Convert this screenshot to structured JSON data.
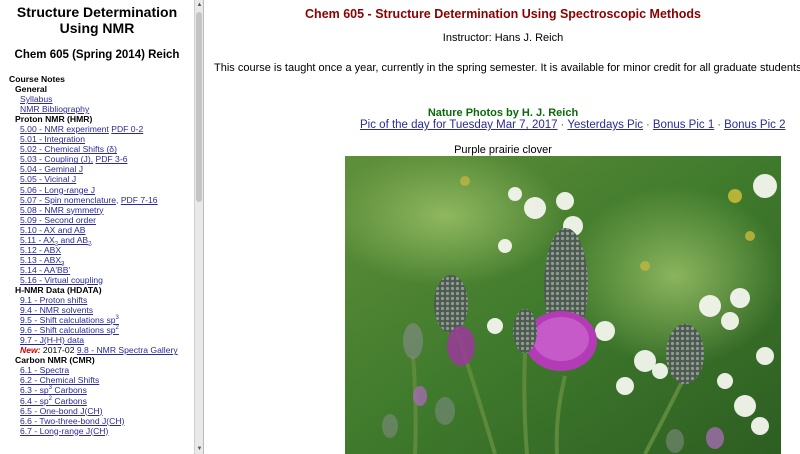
{
  "sidebar": {
    "title": "Structure Determination Using NMR",
    "course": "Chem 605 (Spring 2014) Reich",
    "course_notes": "Course Notes",
    "general": "General",
    "syllabus": "Syllabus",
    "nmr_bibliography": "NMR Bibliography",
    "proton_header": "Proton NMR (HMR)",
    "proton_items": [
      {
        "main": "5.00 - NMR experiment",
        "extra": "PDF 0-2"
      },
      {
        "main": "5.01 - Integration",
        "extra": ""
      },
      {
        "main": "5.02 - Chemical Shifts (δ)",
        "extra": ""
      },
      {
        "main": "5.03 - Coupling (J),",
        "extra": "PDF 3-6"
      },
      {
        "main": "5.04 - Geminal J",
        "extra": ""
      },
      {
        "main": "5.05 - Vicinal J",
        "extra": ""
      },
      {
        "main": "5.06 - Long-range J",
        "extra": ""
      },
      {
        "main": "5.07 - Spin nomenclature,",
        "extra": "PDF 7-16"
      },
      {
        "main": "5.08 - NMR symmetry",
        "extra": ""
      },
      {
        "main": "5.09 - Second order",
        "extra": ""
      },
      {
        "main": "5.10 - AX and AB",
        "extra": ""
      }
    ],
    "item_511": {
      "a": "5.11 - AX",
      "b": "2",
      "c": " and AB",
      "d": "2"
    },
    "item_512": "5.12 - ABX",
    "item_513": {
      "a": "5.13 - ABX",
      "b": "3"
    },
    "item_514": "5.14 - AA'BB'",
    "item_516": "5.16 - Virtual coupling",
    "hdata_header": "H-NMR Data (HDATA)",
    "item_91": "9.1 - Proton shifts",
    "item_94": "9.4 - NMR solvents",
    "item_95a": {
      "a": "9.5 - Shift calculations sp",
      "b": "3"
    },
    "item_95b": {
      "a": "9.6 - Shift calculations sp",
      "b": "2"
    },
    "item_97": "9.7 - J(H-H) data",
    "new_label": "New:",
    "new_date": " 2017-02 ",
    "new_link": "9.8 - NMR Spectra Gallery",
    "carbon_header": "Carbon NMR (CMR)",
    "item_61": "6.1 - Spectra",
    "item_62": "6.2 - Chemical Shifts",
    "item_63": {
      "a": "6.3 - sp",
      "b": "3",
      "c": " Carbons"
    },
    "item_64": {
      "a": "6.4 - sp",
      "b": "2",
      "c": " Carbons"
    },
    "item_65": "6.5 - One-bond J(CH)",
    "item_66": "6.6 - Two-three-bond J(CH)",
    "item_67": "6.7 - Long-range J(CH)"
  },
  "main": {
    "title": "Chem 605 - Structure Determination Using Spectroscopic Methods",
    "instructor": "Instructor: Hans J. Reich",
    "intro": "This course is taught once a year, currently in the spring semester. It is available for minor credit for all graduate students.",
    "photo_title": "Nature Photos by H. J. Reich",
    "pic_of_day": "Pic of the day for Tuesday Mar 7, 2017",
    "yesterdays": "Yesterdays Pic",
    "bonus1": "Bonus Pic 1",
    "bonus2": "Bonus Pic 2",
    "separator": "·",
    "caption": "Purple prairie clover"
  },
  "colors": {
    "title": "#8b0000",
    "photo_title": "#0a6a0a",
    "link": "#2a2a9a",
    "new": "#cc0000"
  },
  "icons": {
    "scroll_up": "triangle-up-icon",
    "scroll_down": "triangle-down-icon"
  }
}
